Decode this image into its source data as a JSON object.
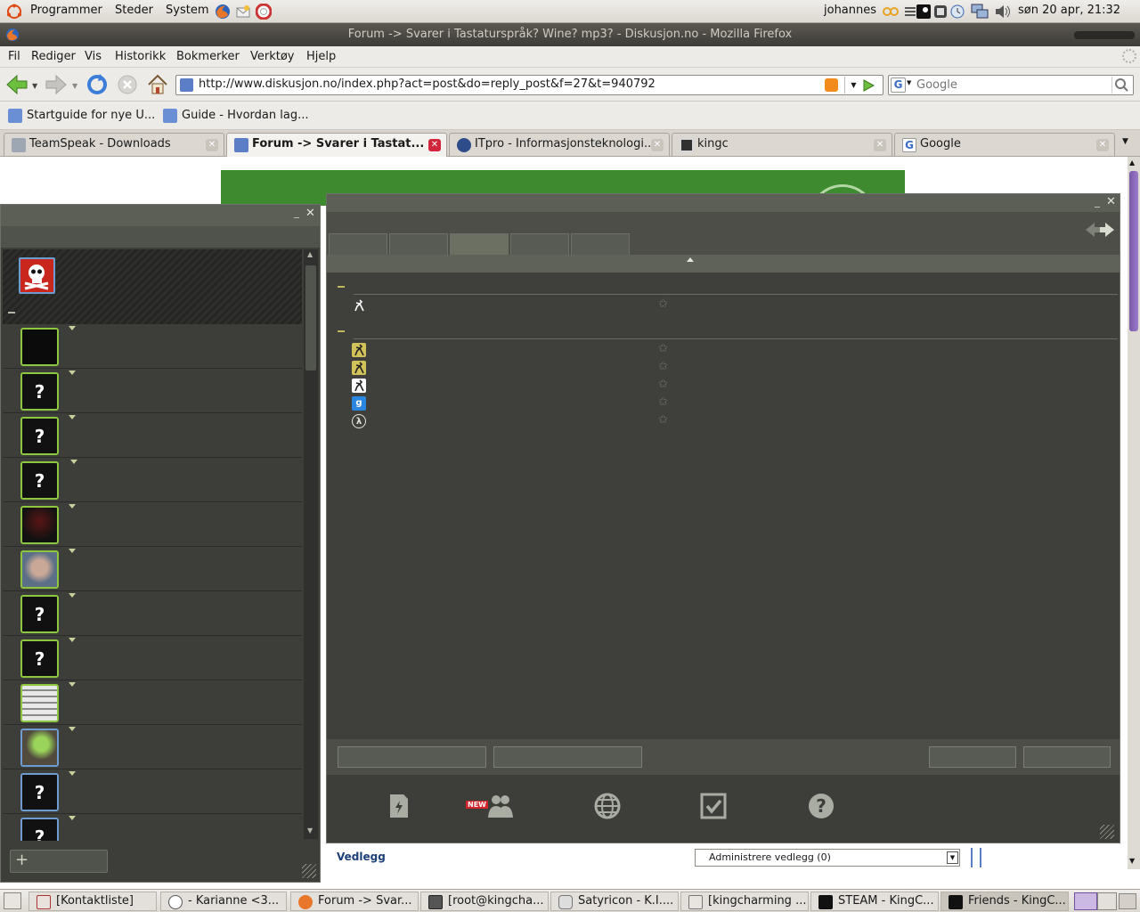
{
  "top_panel": {
    "menus": [
      "Programmer",
      "Steder",
      "System"
    ],
    "user": "johannes",
    "clock": "søn 20 apr, 21:32"
  },
  "window": {
    "title": "Forum -> Svarer i Tastaturspråk? Wine? mp3? - Diskusjon.no - Mozilla Firefox"
  },
  "menubar": [
    "Fil",
    "Rediger",
    "Vis",
    "Historikk",
    "Bokmerker",
    "Verktøy",
    "Hjelp"
  ],
  "navbar": {
    "url": "http://www.diskusjon.no/index.php?act=post&do=reply_post&f=27&t=940792",
    "search_placeholder": "Google"
  },
  "bookmarks": [
    "Startguide for nye U...",
    "Guide - Hvordan lag..."
  ],
  "tabs": [
    {
      "label": "TeamSpeak - Downloads",
      "active": false
    },
    {
      "label": "Forum -> Svarer i Tastat...",
      "active": true
    },
    {
      "label": "ITpro - Informasjonsteknologi...",
      "active": false
    },
    {
      "label": "kingc",
      "active": false
    },
    {
      "label": "Google",
      "active": false
    }
  ],
  "page": {
    "attachments_label": "Vedlegg",
    "manage_attachments": "Administrere vedlegg (0)"
  },
  "dock": {
    "new_badge": "NEW"
  },
  "taskbar": [
    {
      "label": "[Kontaktliste]",
      "active": false
    },
    {
      "label": "- Karianne <3...",
      "active": false
    },
    {
      "label": "Forum -> Svar...",
      "active": false
    },
    {
      "label": "[root@kingcha...",
      "active": false
    },
    {
      "label": "Satyricon - K.I....",
      "active": false
    },
    {
      "label": "[kingcharming ...",
      "active": false
    },
    {
      "label": "STEAM - KingC...",
      "active": false
    },
    {
      "label": "Friends - KingC...",
      "active": true
    }
  ],
  "colors": {
    "steam_bg": "#4c4e47",
    "steam_dark": "#3f403b",
    "friend_border_online": "#8dc63f",
    "friend_border_offline": "#6d9cd2",
    "category_accent": "#c4b65a",
    "page_banner": "#3d8a2f",
    "active_tab_close": "#d0253a"
  }
}
